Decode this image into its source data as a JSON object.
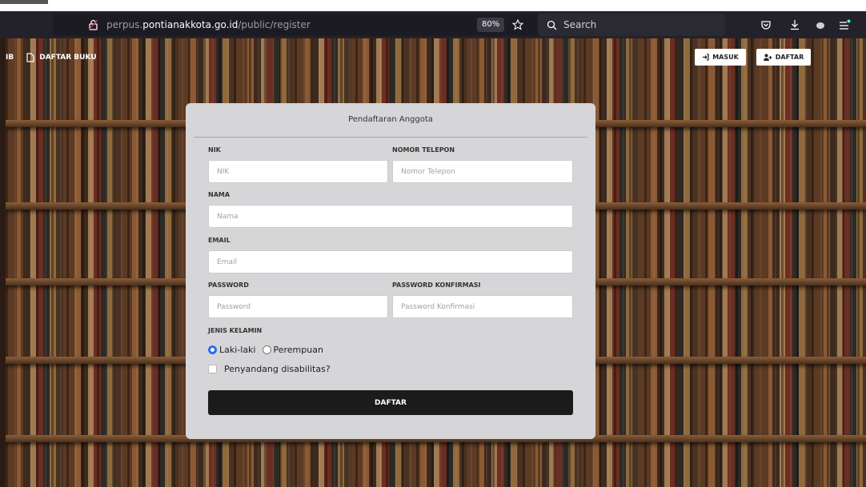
{
  "browser": {
    "url_scheme_host_prefix": "perpus.",
    "url_domain": "pontianakkota.go.id",
    "url_path": "/public/register",
    "zoom": "80%",
    "search_placeholder": "Search"
  },
  "nav": {
    "left_fragment": "IB",
    "daftar_buku": "DAFTAR BUKU",
    "masuk": "MASUK",
    "daftar": "DAFTAR"
  },
  "form": {
    "title": "Pendaftaran Anggota",
    "nik_label": "NIK",
    "nik_placeholder": "NIK",
    "phone_label": "NOMOR TELEPON",
    "phone_placeholder": "Nomor Telepon",
    "nama_label": "NAMA",
    "nama_placeholder": "Nama",
    "email_label": "EMAIL",
    "email_placeholder": "Email",
    "password_label": "PASSWORD",
    "password_placeholder": "Password",
    "password_confirm_label": "PASSWORD KONFIRMASI",
    "password_confirm_placeholder": "Password Konfirmasi",
    "gender_label": "JENIS KELAMIN",
    "gender_options": [
      "Laki-laki",
      "Perempuan"
    ],
    "gender_selected": "Laki-laki",
    "disability_label": "Penyandang disabilitas?",
    "disability_checked": false,
    "submit_label": "DAFTAR"
  },
  "colors": {
    "chrome_bg": "#23222b",
    "card_bg": "#d6d6d9",
    "submit_bg": "#1b1b1b",
    "radio_accent": "#2b6cf3"
  }
}
